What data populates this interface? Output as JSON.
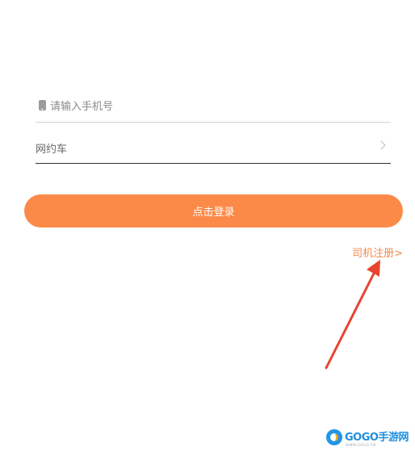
{
  "form": {
    "phone_placeholder": "请输入手机号",
    "service_type": "网约车",
    "login_label": "点击登录",
    "register_label": "司机注册>"
  },
  "watermark": {
    "brand": "GOGO手游网",
    "url": "WWW.GOGO.CN"
  },
  "colors": {
    "accent": "#FB8A49",
    "annotation_arrow": "#E8442E",
    "watermark_blue": "#1E8EE0"
  },
  "icons": {
    "phone": "phone-icon",
    "chevron": "chevron-right-icon"
  }
}
